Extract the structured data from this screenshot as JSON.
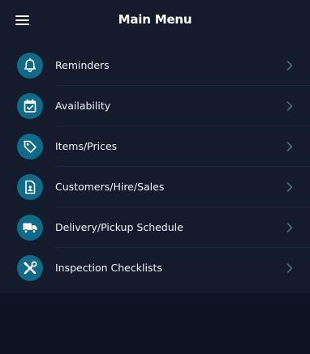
{
  "header": {
    "title": "Main Menu",
    "menu_icon": "hamburger-icon"
  },
  "colors": {
    "background": "#0c1322",
    "panel": "#131b2c",
    "icon_circle": "#0f6b88",
    "text": "#f2f4f7",
    "chevron": "#5a6478"
  },
  "menu": {
    "items": [
      {
        "label": "Reminders",
        "icon": "bell-icon"
      },
      {
        "label": "Availability",
        "icon": "calendar-check-icon"
      },
      {
        "label": "Items/Prices",
        "icon": "price-tag-icon"
      },
      {
        "label": "Customers/Hire/Sales",
        "icon": "contact-card-icon"
      },
      {
        "label": "Delivery/Pickup Schedule",
        "icon": "truck-icon"
      },
      {
        "label": "Inspection Checklists",
        "icon": "tools-icon"
      }
    ]
  }
}
